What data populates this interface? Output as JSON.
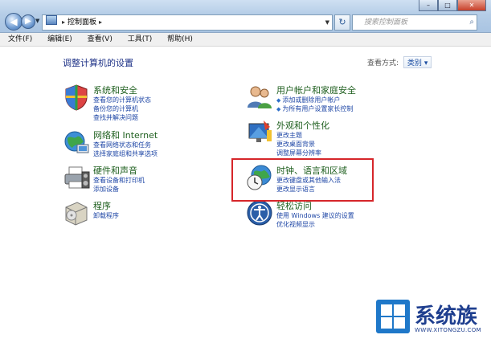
{
  "address_bar": {
    "path_item": "控制面板"
  },
  "search": {
    "placeholder": "搜索控制面板"
  },
  "menu": [
    {
      "label": "文件(F)"
    },
    {
      "label": "编辑(E)"
    },
    {
      "label": "查看(V)"
    },
    {
      "label": "工具(T)"
    },
    {
      "label": "帮助(H)"
    }
  ],
  "page": {
    "title": "调整计算机的设置",
    "view_by_label": "查看方式:",
    "view_by_value": "类别"
  },
  "categories": [
    {
      "title": "系统和安全",
      "links": [
        "查看您的计算机状态",
        "备份您的计算机",
        "查找并解决问题"
      ]
    },
    {
      "title": "网络和 Internet",
      "links": [
        "查看网络状态和任务",
        "选择家庭组和共享选项"
      ]
    },
    {
      "title": "硬件和声音",
      "links": [
        "查看设备和打印机",
        "添加设备"
      ]
    },
    {
      "title": "程序",
      "links": [
        "卸载程序"
      ]
    },
    {
      "title": "用户帐户和家庭安全",
      "links": [
        "添加或删除用户帐户",
        "为所有用户设置家长控制"
      ]
    },
    {
      "title": "外观和个性化",
      "links": [
        "更改主题",
        "更改桌面背景",
        "调整屏幕分辨率"
      ]
    },
    {
      "title": "时钟、语言和区域",
      "links": [
        "更改键盘或其他输入法",
        "更改显示语言"
      ]
    },
    {
      "title": "轻松访问",
      "links": [
        "使用 Windows 建议的设置",
        "优化视频显示"
      ]
    }
  ],
  "watermark": {
    "brand": "系统族",
    "url": "WWW.XITONGZU.COM"
  },
  "colors": {
    "highlight_box": "#d6262a",
    "link": "#1f47a6",
    "category_title": "#1e5f1e"
  }
}
